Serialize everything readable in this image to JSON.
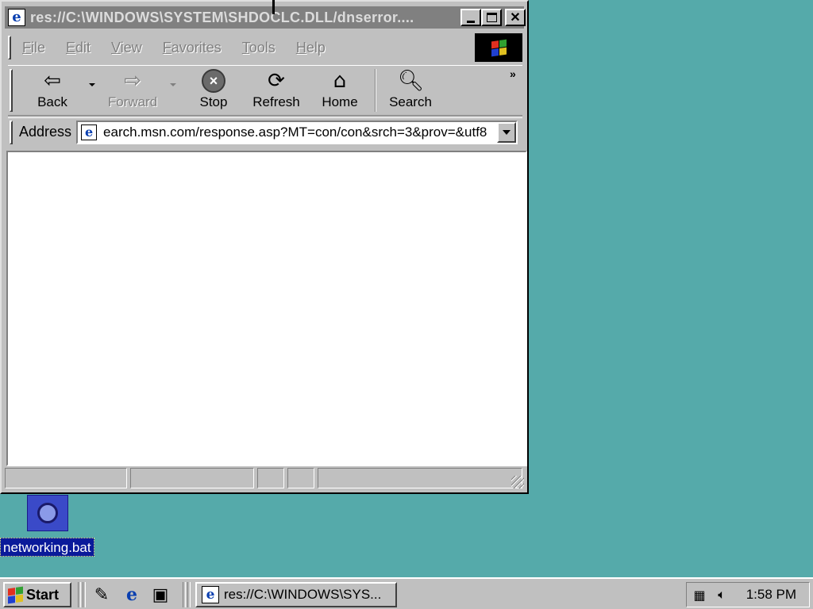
{
  "window": {
    "title": "res://C:\\WINDOWS\\SYSTEM\\SHDOCLC.DLL/dnserror....",
    "menu": [
      "File",
      "Edit",
      "View",
      "Favorites",
      "Tools",
      "Help"
    ],
    "toolbar": {
      "back": "Back",
      "forward": "Forward",
      "stop": "Stop",
      "refresh": "Refresh",
      "home": "Home",
      "search": "Search",
      "chevron": "»"
    },
    "address": {
      "label": "Address",
      "value": "earch.msn.com/response.asp?MT=con/con&srch=3&prov=&utf8"
    }
  },
  "desktop": {
    "icon_label": "networking.bat"
  },
  "taskbar": {
    "start_label": "Start",
    "task_label": "res://C:\\WINDOWS\\SYS...",
    "clock": "1:58 PM"
  },
  "colors": {
    "desktop": "#55aaaa",
    "chrome": "#c0c0c0",
    "titlebar_inactive": "#808080"
  }
}
